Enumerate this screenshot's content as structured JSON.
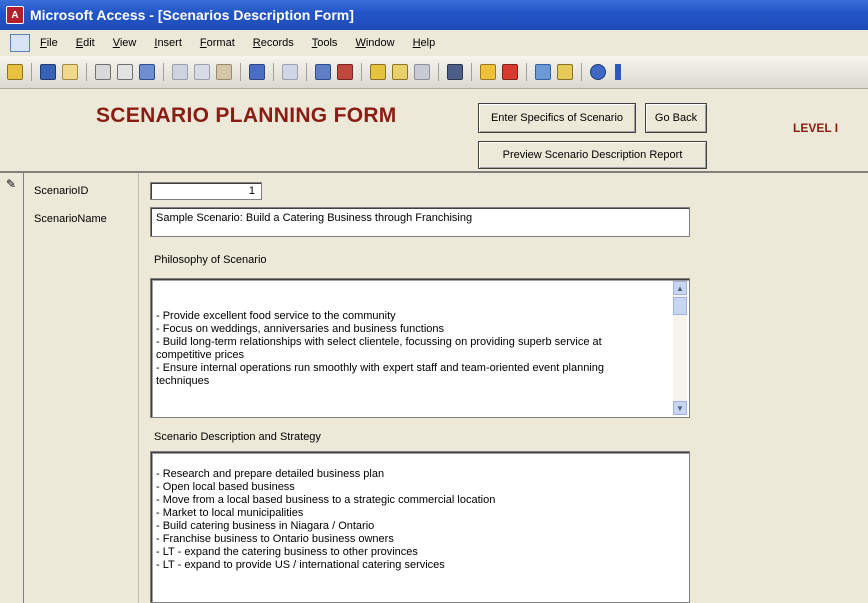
{
  "window": {
    "title": "Microsoft Access - [Scenarios Description Form]"
  },
  "menu": [
    "File",
    "Edit",
    "View",
    "Insert",
    "Format",
    "Records",
    "Tools",
    "Window",
    "Help"
  ],
  "toolbar_icons": [
    "view-icon",
    "save-icon",
    "file-search-icon",
    "print-icon",
    "print-preview-icon",
    "spelling-icon",
    "cut-icon",
    "copy-icon",
    "paste-icon",
    "undo-icon",
    "hyperlink-icon",
    "sort-ascending-icon",
    "sort-descending-icon",
    "filter-by-selection-icon",
    "filter-by-form-icon",
    "apply-filter-icon",
    "find-icon",
    "new-record-icon",
    "delete-record-icon",
    "database-window-icon",
    "new-object-icon",
    "help-icon"
  ],
  "header": {
    "title": "SCENARIO PLANNING FORM",
    "level": "LEVEL I",
    "buttons": {
      "enter_specifics": "Enter Specifics of Scenario",
      "go_back": "Go Back",
      "preview_report": "Preview Scenario Description Report"
    }
  },
  "fields": {
    "scenario_id": {
      "label": "ScenarioID",
      "value": "1"
    },
    "scenario_name": {
      "label": "ScenarioName",
      "value": "Sample Scenario:  Build a Catering Business through Franchising"
    },
    "philosophy": {
      "label": "Philosophy of Scenario",
      "value": "- Provide excellent food service to the community\n- Focus on weddings, anniversaries and business functions\n- Build long-term relationships with select clientele, focussing on providing superb service at\n  competitive prices\n- Ensure internal operations run smoothly with expert staff and team-oriented event planning\n  techniques"
    },
    "strategy": {
      "label": "Scenario Description and Strategy",
      "value": "- Research and prepare detailed business plan\n- Open local based business\n- Move from a local based business to a strategic commercial location\n- Market to local municipalities\n- Build catering business in Niagara / Ontario\n- Franchise business to Ontario business owners\n- LT - expand the catering business to other provinces\n- LT - expand to provide US / international catering services"
    }
  }
}
